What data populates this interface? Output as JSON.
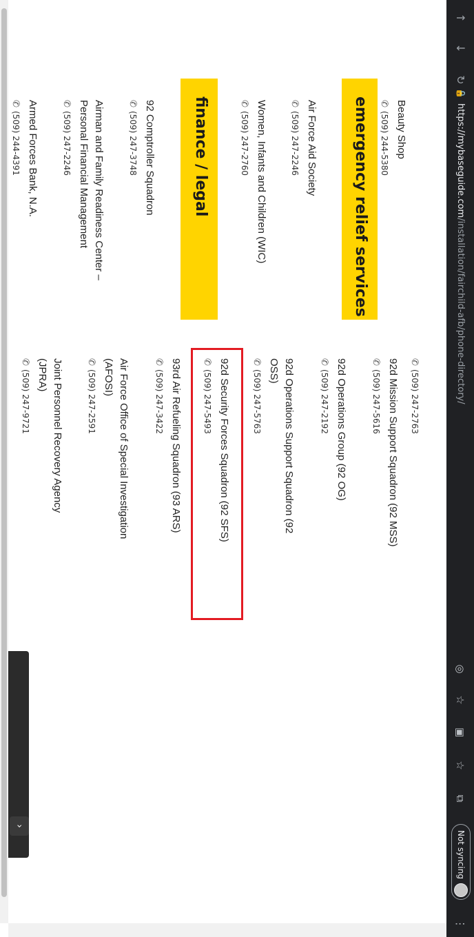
{
  "browser": {
    "url_scheme": "https://",
    "url_host": "mybaseguide.com",
    "url_path": "/installation/fairchild-afb/phone-directory/",
    "sync_label": "Not syncing"
  },
  "directory": {
    "col1": [
      {
        "name": "Beauty Shop",
        "phone": "(509) 244-5380"
      }
    ],
    "emergency_heading": "emergency relief services",
    "emergency": [
      {
        "name": "Air Force Aid Society",
        "phone": "(509) 247-2246"
      },
      {
        "name": "Women, Infants and Children (WIC)",
        "phone": "(509) 247-2760"
      }
    ],
    "finance_heading": "finance / legal",
    "finance": [
      {
        "name": "92 Comptroller Squadron",
        "phone": "(509) 247-3748"
      },
      {
        "name": "Airman and Family Readiness Center –\nPersonal Financial Management",
        "phone": "(509) 247-2246"
      },
      {
        "name": "Armed Forces Bank, N.A.",
        "phone": "(509) 244-4391"
      }
    ],
    "col2": [
      {
        "name": "",
        "phone": "(509) 247-2763"
      },
      {
        "name": "92d Mission Support Squadron (92 MSS)",
        "phone": "(509) 247-5616"
      },
      {
        "name": "92d Operations Group (92 OG)",
        "phone": "(509) 247-2192"
      },
      {
        "name": "92d Operations Support Squadron (92\nOSS)",
        "phone": "(509) 247-5763"
      },
      {
        "name": "92d Security Forces Squadron (92 SFS)",
        "phone": "(509) 247-5493"
      },
      {
        "name": "93rd Air Refueling Squadron (93 ARS)",
        "phone": "(509) 247-3422"
      },
      {
        "name": "Air Force Office of Special Investigation\n(AFOSI)",
        "phone": "(509) 247-2591"
      },
      {
        "name": "Joint Personnel Recovery Agency\n(JPRA)",
        "phone": "(509) 247-9721"
      }
    ]
  },
  "colors": {
    "banner": "#ffd400",
    "highlight": "#e31b23"
  }
}
